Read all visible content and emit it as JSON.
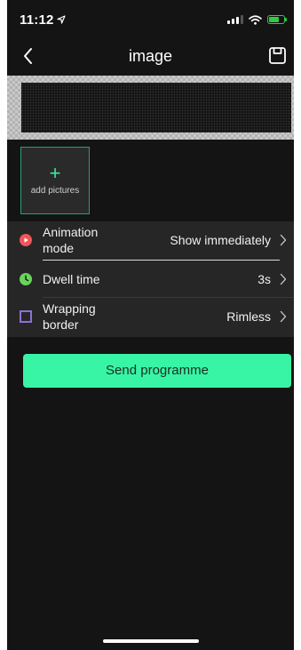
{
  "status_bar": {
    "time": "11:12"
  },
  "nav": {
    "title": "image"
  },
  "add_pictures": {
    "plus": "+",
    "label": "add pictures"
  },
  "settings": {
    "animation_mode": {
      "label": "Animation mode",
      "value": "Show immediately",
      "icon": "play-circle-icon",
      "icon_color": "#f0555a"
    },
    "dwell_time": {
      "label": "Dwell time",
      "value": "3s",
      "icon": "clock-icon",
      "icon_color": "#6ad35a"
    },
    "wrapping_border": {
      "label": "Wrapping border",
      "value": "Rimless",
      "icon": "border-square-icon",
      "icon_color": "#8e6fd6"
    }
  },
  "send_button": {
    "label": "Send programme"
  },
  "colors": {
    "background": "#141414",
    "list_background": "#262626",
    "accent": "#37f5a5",
    "accent_border": "#28a06e"
  },
  "battery_level": 0.75
}
